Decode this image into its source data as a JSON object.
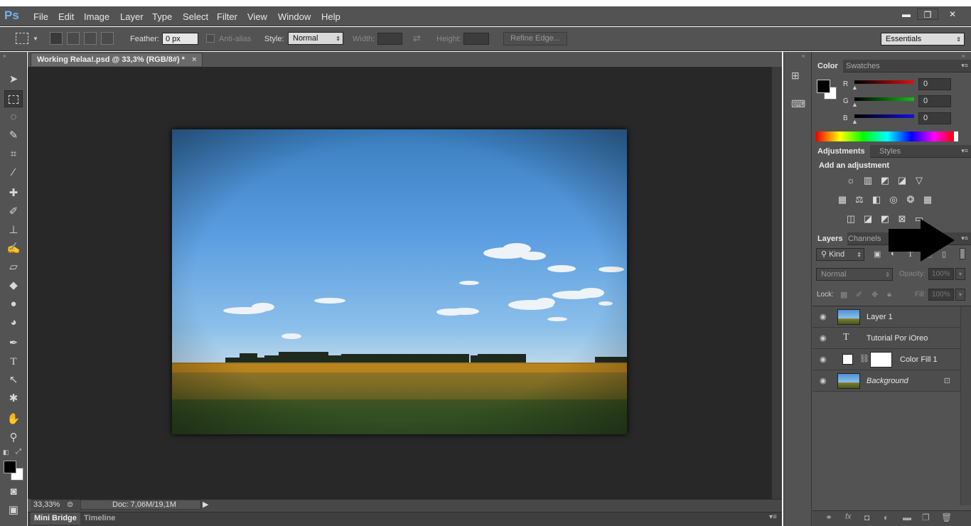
{
  "app": {
    "logo": "Ps"
  },
  "menu": [
    "File",
    "Edit",
    "Image",
    "Layer",
    "Type",
    "Select",
    "Filter",
    "View",
    "Window",
    "Help"
  ],
  "window_controls": {
    "minimize": "▬",
    "restore": "❐",
    "close": "✕"
  },
  "options_bar": {
    "feather_label": "Feather:",
    "feather_value": "0 px",
    "antialias_label": "Anti-alias",
    "style_label": "Style:",
    "style_value": "Normal",
    "width_label": "Width:",
    "height_label": "Height:",
    "refine_edge_label": "Refine Edge...",
    "workspace_value": "Essentials"
  },
  "document": {
    "tab_title": "Working Relaa!.psd @ 33,3% (RGB/8#) *",
    "close_glyph": "×",
    "zoom": "33,33%",
    "doc_size": "Doc: 7,06M/19,1M"
  },
  "bottom_tabs": [
    "Mini Bridge",
    "Timeline"
  ],
  "color_panel": {
    "tabs": [
      "Color",
      "Swatches"
    ],
    "channels": [
      {
        "label": "R",
        "value": "0",
        "color": "#e01010"
      },
      {
        "label": "G",
        "value": "0",
        "color": "#10c010"
      },
      {
        "label": "B",
        "value": "0",
        "color": "#1010e0"
      }
    ]
  },
  "adjustments_panel": {
    "tabs": [
      "Adjustments",
      "Styles"
    ],
    "heading": "Add an adjustment"
  },
  "layers_panel": {
    "tabs": [
      "Layers",
      "Channels"
    ],
    "filter_kind": "Kind",
    "blend_mode": "Normal",
    "opacity_label": "Opacity:",
    "opacity_value": "100%",
    "lock_label": "Lock:",
    "fill_label": "Fill:",
    "fill_value": "100%",
    "layers": [
      {
        "name": "Layer 1",
        "type": "image"
      },
      {
        "name": "Tutorial Por  iOreo",
        "type": "text"
      },
      {
        "name": "Color Fill 1",
        "type": "fill"
      },
      {
        "name": "Background",
        "type": "background"
      }
    ]
  }
}
